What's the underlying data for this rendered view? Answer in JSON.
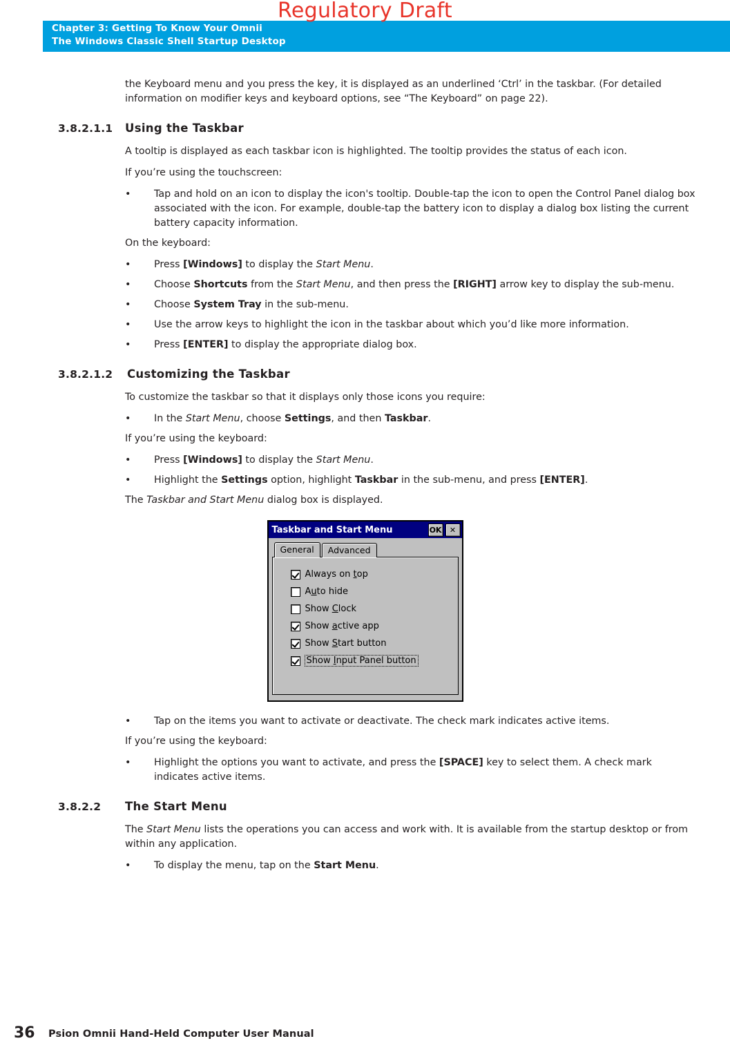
{
  "watermark": "Regulatory Draft",
  "header": {
    "line1": "Chapter 3:  Getting To Know Your Omnii",
    "line2": "The Windows Classic Shell Startup Desktop"
  },
  "body": {
    "intro": "the Keyboard menu and you press the key, it is displayed as an underlined ‘Ctrl’ in the taskbar. (For detailed information on modifier keys and keyboard options, see “The Keyboard” on page 22).",
    "section_1": {
      "number": "3.8.2.1.1",
      "title": "Using the Taskbar",
      "p1": "A tooltip is displayed as each taskbar icon is highlighted. The tooltip provides the status of each icon.",
      "p2": "If you’re using the touchscreen:",
      "b1": "Tap and hold on an icon to display the icon's tooltip. Double-tap the icon to open the Control Panel dialog box associated with the icon. For example, double-tap the battery icon to display a dialog box listing the current battery capacity information.",
      "p3": "On the keyboard:",
      "b2_pre": "Press ",
      "b2_bold": "[Windows]",
      "b2_mid": " to display the ",
      "b2_ital": "Start Menu",
      "b2_end": ".",
      "b3_pre": "Choose ",
      "b3_bold1": "Shortcuts",
      "b3_mid1": " from the ",
      "b3_ital": "Start Menu",
      "b3_mid2": ", and then press the ",
      "b3_bold2": "[RIGHT]",
      "b3_end": " arrow key to display the sub-menu.",
      "b4_pre": "Choose ",
      "b4_bold": "System Tray",
      "b4_end": " in the sub-menu.",
      "b5": "Use the arrow keys to highlight the icon in the taskbar about which you’d like more information.",
      "b6_pre": "Press ",
      "b6_bold": "[ENTER]",
      "b6_end": " to display the appropriate dialog box."
    },
    "section_2": {
      "number": "3.8.2.1.2",
      "title": "Customizing the Taskbar",
      "p1": "To customize the taskbar so that it displays only those icons you require:",
      "b1_pre": "In the ",
      "b1_ital": "Start Menu",
      "b1_mid1": ", choose ",
      "b1_bold1": "Settings",
      "b1_mid2": ", and then ",
      "b1_bold2": "Taskbar",
      "b1_end": ".",
      "p2": "If you’re using the keyboard:",
      "b2_pre": "Press ",
      "b2_bold": "[Windows]",
      "b2_mid": " to display the ",
      "b2_ital": "Start Menu",
      "b2_end": ".",
      "b3_pre": "Highlight the ",
      "b3_bold1": "Settings",
      "b3_mid1": " option, highlight ",
      "b3_bold2": "Taskbar",
      "b3_mid2": " in the sub-menu, and press ",
      "b3_bold3": "[ENTER]",
      "b3_end": ".",
      "p3_pre": "The ",
      "p3_ital": "Taskbar and Start Menu",
      "p3_end": " dialog box is displayed.",
      "b4": "Tap on the items you want to activate or deactivate. The check mark indicates active items.",
      "p4": "If you’re using the keyboard:",
      "b5_pre": "Highlight the options you want to activate, and press the ",
      "b5_bold": "[SPACE]",
      "b5_end": " key to select them. A check mark indicates active items."
    },
    "section_3": {
      "number": "3.8.2.2",
      "title": "The Start Menu",
      "p1_pre": "The ",
      "p1_ital": "Start Menu",
      "p1_end": " lists the operations you can access and work with. It is available from the startup desktop or from within any application.",
      "b1_pre": "To display the menu, tap on the ",
      "b1_bold": "Start Menu",
      "b1_end": "."
    },
    "bullet_glyph": "•"
  },
  "dialog": {
    "title": "Taskbar and Start Menu",
    "ok_label": "OK",
    "close_label": "✕",
    "tabs": [
      {
        "label": "General",
        "active": true
      },
      {
        "label": "Advanced",
        "active": false
      }
    ],
    "options": [
      {
        "label_pre": "Always on ",
        "label_key": "t",
        "label_post": "op",
        "checked": true,
        "focus": false
      },
      {
        "label_pre": "A",
        "label_key": "u",
        "label_post": "to hide",
        "checked": false,
        "focus": false
      },
      {
        "label_pre": "Show ",
        "label_key": "C",
        "label_post": "lock",
        "checked": false,
        "focus": false
      },
      {
        "label_pre": "Show ",
        "label_key": "a",
        "label_post": "ctive app",
        "checked": true,
        "focus": false
      },
      {
        "label_pre": "Show ",
        "label_key": "S",
        "label_post": "tart button",
        "checked": true,
        "focus": false
      },
      {
        "label_pre": "Show ",
        "label_key": "I",
        "label_post": "nput Panel button",
        "checked": true,
        "focus": true
      }
    ]
  },
  "footer": {
    "page_number": "36",
    "title": "Psion Omnii Hand-Held Computer User Manual"
  }
}
